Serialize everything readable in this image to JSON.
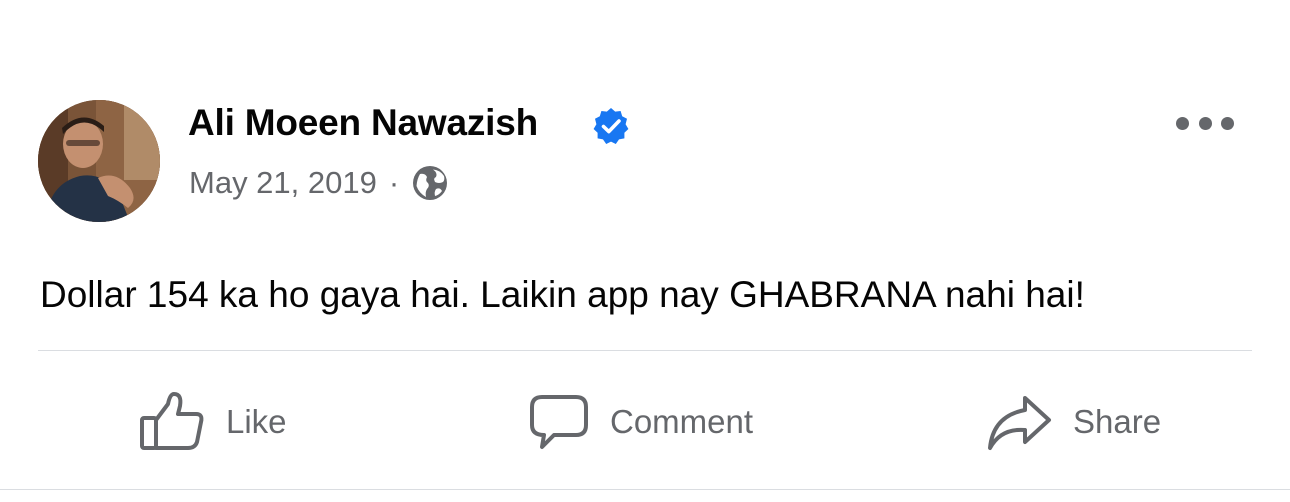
{
  "post": {
    "author": {
      "name": "Ali Moeen Nawazish",
      "verified": true,
      "avatar": "avatar-photo"
    },
    "meta": {
      "date": "May 21, 2019",
      "separator": "·",
      "audience_icon": "globe-icon"
    },
    "more_icon": "more-options-icon",
    "text": "Dollar 154 ka ho gaya hai. Laikin app nay GHABRANA nahi hai!",
    "actions": {
      "like": {
        "label": "Like",
        "icon": "thumbs-up-icon"
      },
      "comment": {
        "label": "Comment",
        "icon": "comment-bubble-icon"
      },
      "share": {
        "label": "Share",
        "icon": "share-arrow-icon"
      }
    }
  },
  "colors": {
    "text_primary": "#050505",
    "text_secondary": "#65676b",
    "verified_blue": "#1877f2",
    "divider": "#dadde1"
  }
}
